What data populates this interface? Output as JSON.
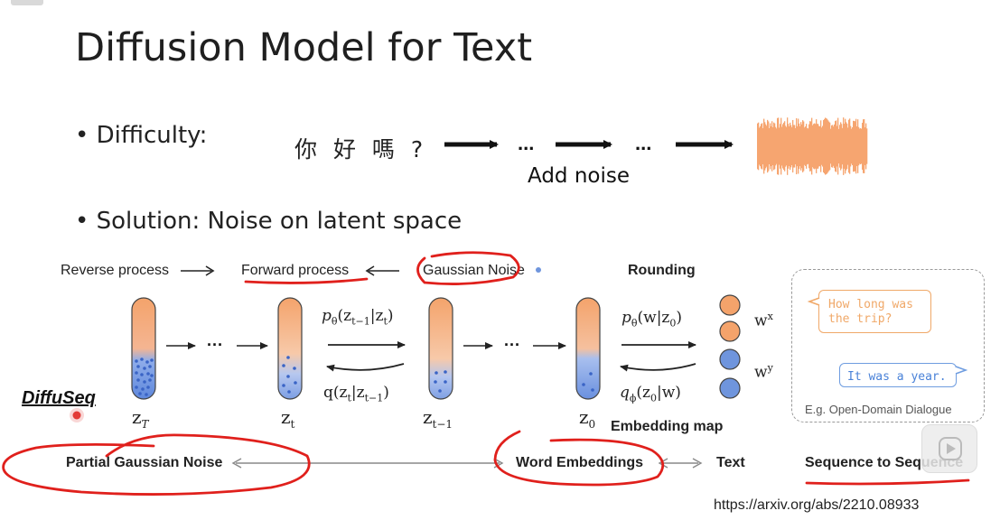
{
  "slide": {
    "title": "Diffusion Model for Text",
    "difficulty_label": "• Difficulty:",
    "chinese_text": "你 好 嗎 ?",
    "dots": "...",
    "add_noise": "Add noise",
    "solution_label": "• Solution: Noise on latent space"
  },
  "figure": {
    "reverse_process": "Reverse process",
    "forward_process": "Forward process",
    "gaussian_noise": "Gaussian Noise",
    "rounding": "Rounding",
    "embedding_map": "Embedding map",
    "dots": "···",
    "z_T": "z",
    "z_T_sub": "T",
    "z_t": "z",
    "z_t_sub": "t",
    "z_t1": "z",
    "z_t1_sub": "t−1",
    "z_0": "z",
    "z_0_sub": "0",
    "p_theta": "p",
    "p_theta_sub": "θ",
    "p_theta_args": "(z",
    "p_theta_args_sub": "t−1",
    "p_theta_args_end": "|z",
    "p_theta_args_end_sub": "t",
    "p_theta_close": ")",
    "q_label": "q(z",
    "q_sub1": "t",
    "q_mid": "|z",
    "q_sub2": "t−1",
    "q_close": ")",
    "p_w": "p",
    "p_w_sub": "θ",
    "p_w_args": "(w|z",
    "p_w_args_sub": "0",
    "p_w_close": ")",
    "q_phi": "q",
    "q_phi_sub": "ϕ",
    "q_phi_args": "(z",
    "q_phi_args_sub": "0",
    "q_phi_close": "|w)",
    "w_x": "w",
    "w_x_sup": "x",
    "w_y": "w",
    "w_y_sup": "y",
    "bubble_question": [
      "How long was",
      "the trip?"
    ],
    "bubble_answer": "It was a year.",
    "dialogue_caption": "E.g. Open-Domain Dialogue",
    "partial_gaussian_noise": "Partial Gaussian Noise",
    "word_embeddings": "Word Embeddings",
    "text_label": "Text",
    "seq2seq": "Sequence to Sequence"
  },
  "annotation": {
    "diffuseq": "DiffuSeq"
  },
  "footer": {
    "url": "https://arxiv.org/abs/2210.08933"
  },
  "colors": {
    "orange": "#f4a36b",
    "blue": "#6f95dd",
    "red_ink": "#e0201c",
    "bubble_orange": "#f0a868",
    "bubble_blue": "#6f9de0"
  }
}
